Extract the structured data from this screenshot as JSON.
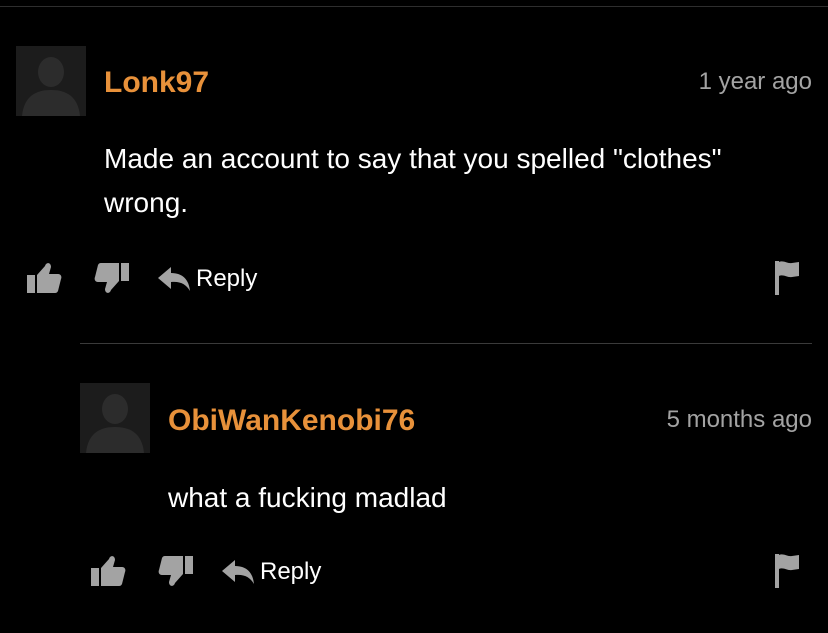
{
  "theme": {
    "background": "#000000",
    "username_color": "#e8913a",
    "timestamp_color": "#a3a3a3",
    "icon_color": "#a3a3a3",
    "text_color": "#ffffff"
  },
  "comments": [
    {
      "username": "Lonk97",
      "timestamp": "1 year ago",
      "body_lines": [
        "Made an account to say that you spelled \"clothes\"",
        "wrong."
      ],
      "avatar": "default-avatar-icon",
      "actions": {
        "upvote_icon": "thumbs-up-icon",
        "downvote_icon": "thumbs-down-icon",
        "reply_icon": "reply-arrow-icon",
        "reply_label": "Reply",
        "flag_icon": "flag-icon"
      }
    },
    {
      "username": "ObiWanKenobi76",
      "timestamp": "5 months ago",
      "body_lines": [
        "what a fucking madlad"
      ],
      "avatar": "default-avatar-icon",
      "actions": {
        "upvote_icon": "thumbs-up-icon",
        "downvote_icon": "thumbs-down-icon",
        "reply_icon": "reply-arrow-icon",
        "reply_label": "Reply",
        "flag_icon": "flag-icon"
      }
    }
  ]
}
